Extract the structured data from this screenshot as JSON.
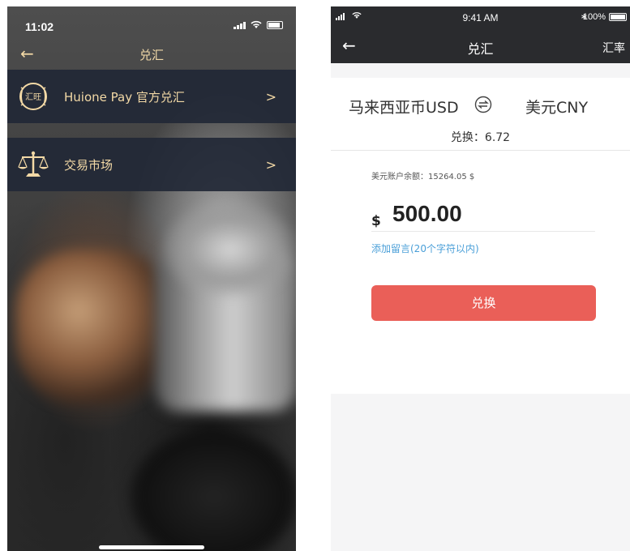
{
  "left_screen": {
    "status_bar": {
      "time": "11:02"
    },
    "nav": {
      "back_icon": "arrow-left-icon",
      "title": "兑汇"
    },
    "menu": [
      {
        "icon": "huiwang-badge-icon",
        "badge_text": "汇旺",
        "label": "Huione Pay 官方兑汇",
        "arrow": ">"
      },
      {
        "icon": "scales-icon",
        "label": "交易市场",
        "arrow": ">"
      }
    ],
    "accent_color": "#f3d9a6"
  },
  "right_screen": {
    "status_bar": {
      "time": "9:41 AM",
      "battery": "100%"
    },
    "nav": {
      "back_icon": "arrow-left-icon",
      "title": "兑汇",
      "rate_link": "汇率"
    },
    "conversion": {
      "from_currency": "马来西亚币USD",
      "to_currency": "美元CNY",
      "rate_text": "兑换：6.72"
    },
    "form": {
      "balance_text": "美元账户余额：15264.05 $",
      "currency_symbol": "$",
      "amount": "500.00",
      "memo_link": "添加留言(20个字符以内)",
      "submit_label": "兑换"
    },
    "colors": {
      "button": "#ea5f58",
      "link": "#4a9fd8",
      "header": "#2a2b2e"
    }
  }
}
